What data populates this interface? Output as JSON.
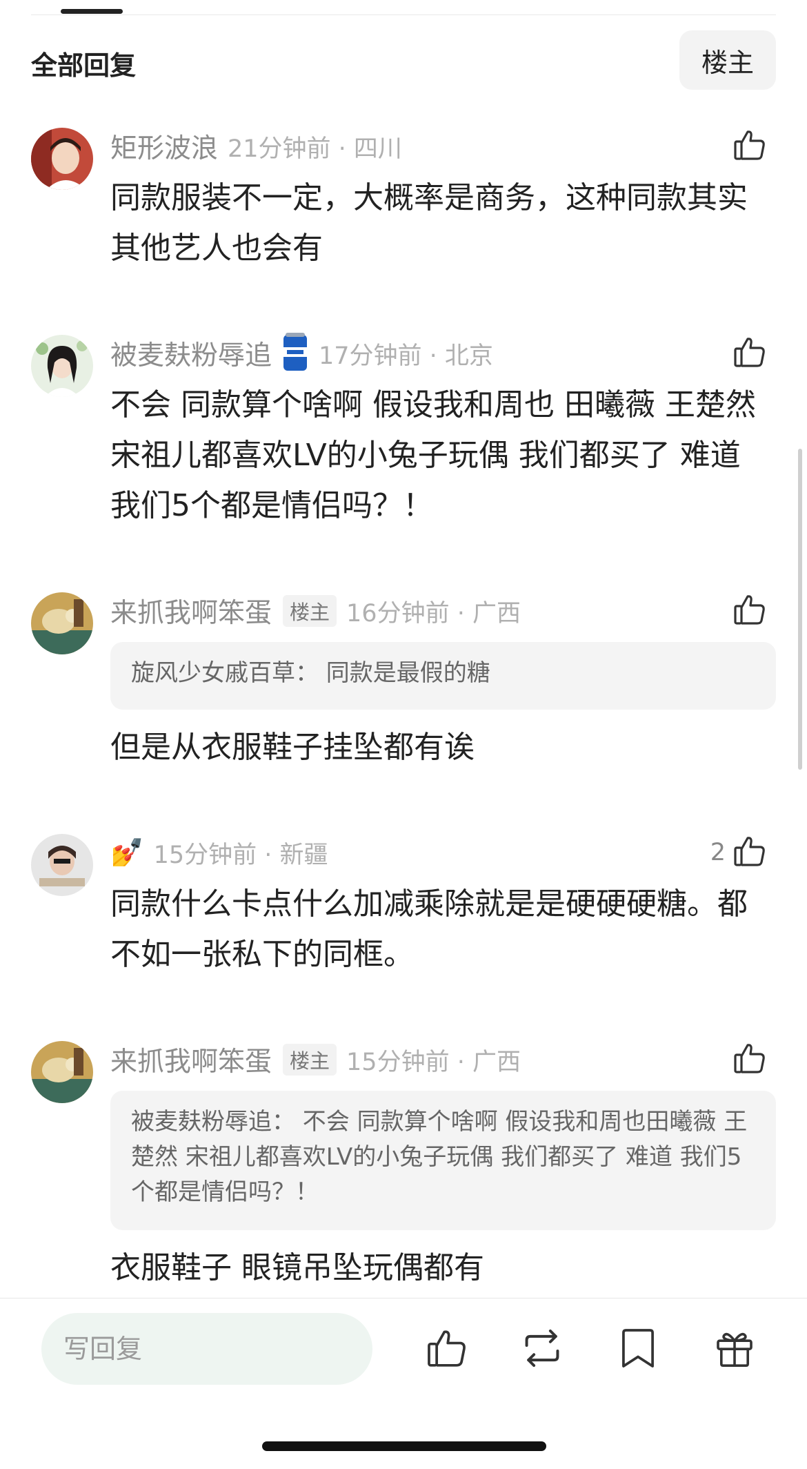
{
  "header": {
    "title": "全部回复",
    "op_button": "楼主"
  },
  "comments": [
    {
      "username": "矩形波浪",
      "time_location": "21分钟前 · 四川",
      "body": "同款服装不一定，大概率是商务，这种同款其实其他艺人也会有"
    },
    {
      "username": "被麦麸粉辱追",
      "time_location": "17分钟前 · 北京",
      "body": "不会 同款算个啥啊 假设我和周也 田曦薇 王楚然 宋祖儿都喜欢LV的小兔子玩偶 我们都买了 难道 我们5个都是情侣吗？！"
    },
    {
      "username": "来抓我啊笨蛋",
      "badge": "楼主",
      "time_location": "16分钟前 · 广西",
      "quote": "旋风少女戚百草：  同款是最假的糖",
      "body": "但是从衣服鞋子挂坠都有诶"
    },
    {
      "username": "💅",
      "time_location": "15分钟前 · 新疆",
      "likes": "2",
      "body": "同款什么卡点什么加减乘除就是是硬硬硬糖。都不如一张私下的同框。"
    },
    {
      "username": "来抓我啊笨蛋",
      "badge": "楼主",
      "time_location": "15分钟前 · 广西",
      "quote": "被麦麸粉辱追：  不会 同款算个啥啊 假设我和周也田曦薇 王楚然 宋祖儿都喜欢LV的小兔子玩偶 我们都买了 难道 我们5个都是情侣吗？！",
      "body": "衣服鞋子 眼镜吊坠玩偶都有"
    }
  ],
  "bottom_bar": {
    "reply_placeholder": "写回复"
  },
  "icons": {
    "like": "thumbs-up-icon",
    "repost": "repost-icon",
    "bookmark": "bookmark-icon",
    "gift": "gift-icon"
  },
  "colors": {
    "text": "#222222",
    "meta": "#8c8c8c",
    "quote_bg": "#f4f4f4",
    "input_bg": "#eef5f1"
  }
}
